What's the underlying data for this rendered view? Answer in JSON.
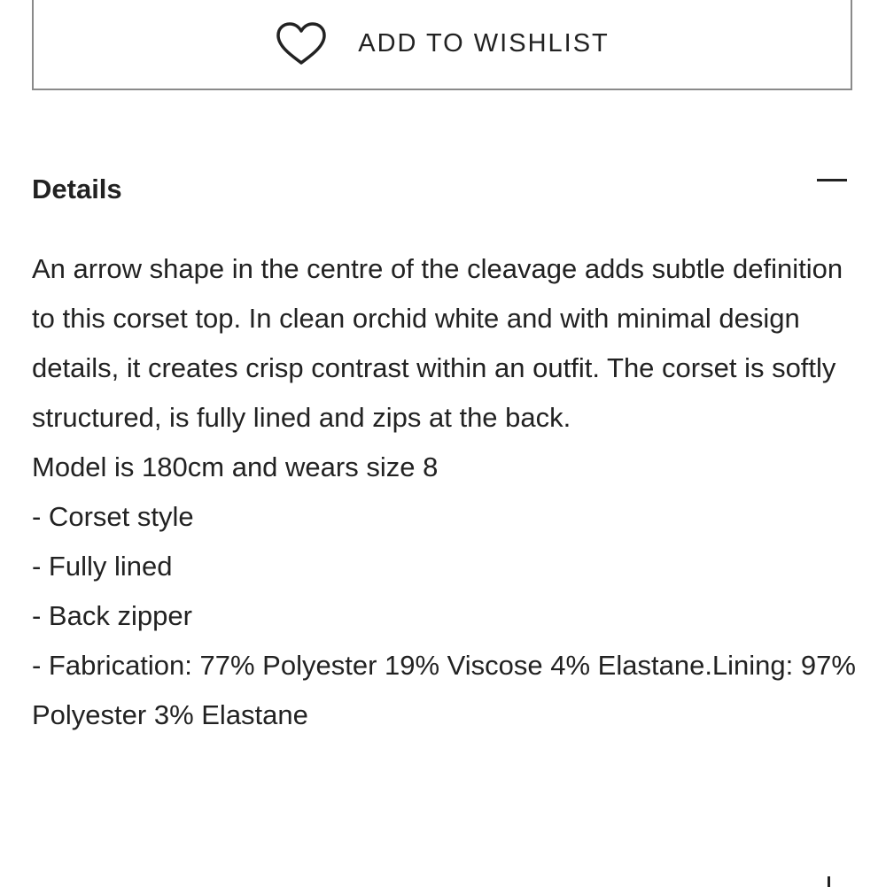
{
  "wishlist": {
    "label": "ADD TO WISHLIST",
    "icon": "heart-outline-icon"
  },
  "details": {
    "title": "Details",
    "toggle_icon": "minus-icon",
    "description": "An arrow shape in the centre of the cleavage adds subtle definition to this corset top. In clean orchid white and with minimal design details, it creates crisp contrast within an outfit. The corset is softly structured, is fully lined and zips at the back.",
    "model_info": "Model is 180cm and wears size 8",
    "features": [
      "- Corset style",
      "- Fully lined",
      "- Back zipper",
      "- Fabrication: 77% Polyester 19% Viscose 4% Elastane.Lining: 97% Polyester 3% Elastane"
    ]
  },
  "colors": {
    "text": "#222222",
    "border": "#8a8a8a",
    "background": "#ffffff"
  }
}
